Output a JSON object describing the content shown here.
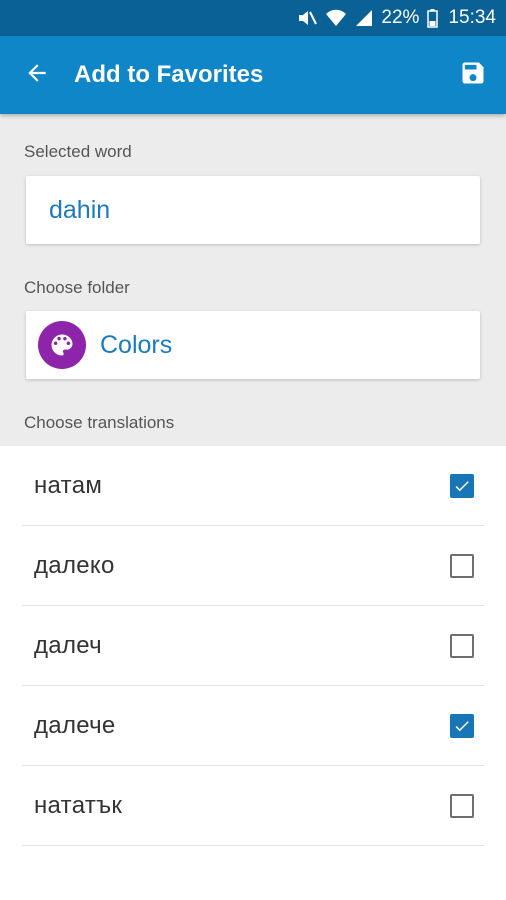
{
  "status_bar": {
    "battery": "22%",
    "time": "15:34"
  },
  "app_bar": {
    "title": "Add to Favorites"
  },
  "selected_word": {
    "label": "Selected word",
    "value": "dahin"
  },
  "folder": {
    "label": "Choose folder",
    "name": "Colors",
    "icon": "palette-icon",
    "icon_color": "#8e24aa"
  },
  "translations": {
    "label": "Choose translations",
    "items": [
      {
        "text": "натам",
        "checked": true
      },
      {
        "text": "далеко",
        "checked": false
      },
      {
        "text": "далеч",
        "checked": false
      },
      {
        "text": "далече",
        "checked": true
      },
      {
        "text": "нататък",
        "checked": false
      }
    ]
  },
  "colors": {
    "status_bar": "#0a6196",
    "app_bar": "#0e86c7",
    "accent": "#1a7bbf",
    "checkbox_checked": "#1676b8"
  }
}
